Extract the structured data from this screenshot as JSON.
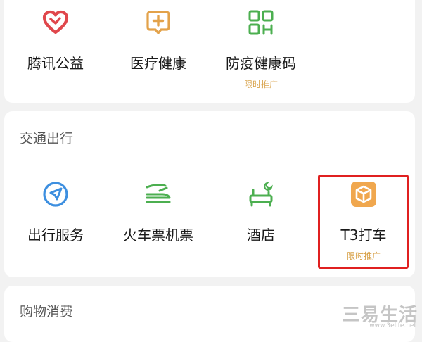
{
  "top_section": {
    "items": [
      {
        "label": "腾讯公益",
        "icon": "heart-icon"
      },
      {
        "label": "医疗健康",
        "icon": "medical-cross-icon"
      },
      {
        "label": "防疫健康码",
        "icon": "qr-code-icon",
        "promo": "限时推广"
      }
    ]
  },
  "travel_section": {
    "title": "交通出行",
    "items": [
      {
        "label": "出行服务",
        "icon": "navigation-arrow-icon"
      },
      {
        "label": "火车票机票",
        "icon": "train-icon"
      },
      {
        "label": "酒店",
        "icon": "hotel-bed-icon"
      },
      {
        "label": "T3打车",
        "icon": "t3-car-icon",
        "promo": "限时推广"
      }
    ]
  },
  "shopping_section": {
    "title": "购物消费"
  },
  "watermark": {
    "text": "三易生活",
    "url": "www.3elife.net"
  },
  "colors": {
    "heart": "#e0474c",
    "medical": "#e3a24a",
    "green": "#4caf50",
    "blue": "#3d8fe0",
    "t3": "#f0a74e",
    "promo": "#d8a24a",
    "highlight": "#e02020"
  }
}
